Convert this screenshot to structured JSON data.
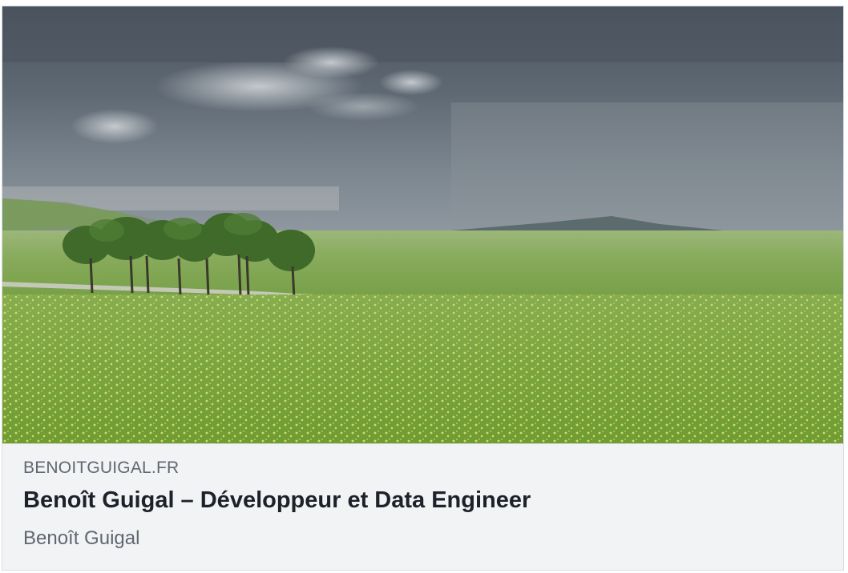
{
  "link_preview": {
    "image": {
      "description": "landscape-photo"
    },
    "domain": "BENOITGUIGAL.FR",
    "title": "Benoît Guigal – Développeur et Data Engineer",
    "description": "Benoît Guigal"
  },
  "colors": {
    "card_background": "#f2f3f5",
    "border": "#dadde1",
    "domain_text": "#606770",
    "title_text": "#1d2129",
    "description_text": "#606770"
  }
}
